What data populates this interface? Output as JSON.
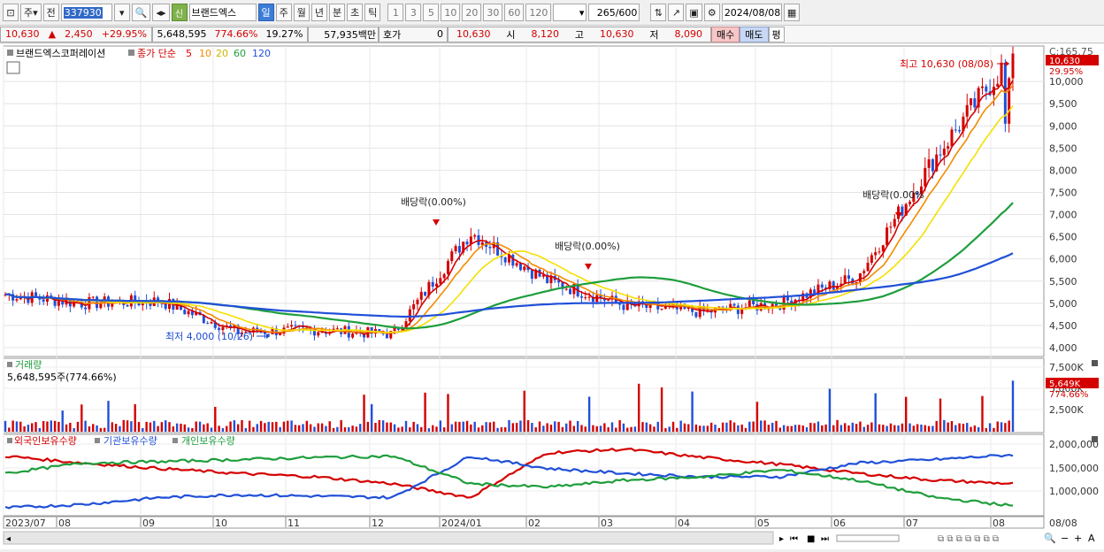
{
  "toolbar": {
    "period_type": "주",
    "prev_label": "전",
    "code": "337930",
    "new_badge": "신",
    "stock_name": "브랜드엑스",
    "intervals": [
      "일",
      "주",
      "월",
      "년",
      "분",
      "초",
      "틱"
    ],
    "selected_interval": "일",
    "numbers": [
      "1",
      "3",
      "5",
      "10",
      "20",
      "30",
      "60",
      "120"
    ],
    "count": "265",
    "count_max": "/600",
    "date": "2024/08/08"
  },
  "quote": {
    "price": "10,630",
    "change": "2,450",
    "change_pct": "+29.95%",
    "volume": "5,648,595",
    "volume_ratio": "774.66%",
    "turnover": "19.27%",
    "amount": "57,935백만",
    "hoga_label": "호가",
    "hoga_value": "0",
    "bid": "10,630",
    "open_label": "시",
    "open": "8,120",
    "high_label": "고",
    "high": "10,630",
    "low_label": "저",
    "low": "8,090",
    "buy_label": "매수",
    "sell_label": "매도",
    "avg_label": "평"
  },
  "price_panel": {
    "stock_label": "브랜드엑스코퍼레이션",
    "ma_title": "종가 단순",
    "ma_periods": [
      "5",
      "10",
      "20",
      "60",
      "120"
    ],
    "ma_colors": [
      "#d40000",
      "#f28c00",
      "#f5e000",
      "#1e9e3c",
      "#2050d8"
    ],
    "top_label": "C:165.75",
    "current_box": "10,630",
    "current_pct": "29.95%",
    "y_ticks": [
      "10,000",
      "9,500",
      "9,000",
      "8,500",
      "8,000",
      "7,500",
      "7,000",
      "6,500",
      "6,000",
      "5,500",
      "5,000",
      "4,500",
      "4,000"
    ],
    "y_values": [
      10000,
      9500,
      9000,
      8500,
      8000,
      7500,
      7000,
      6500,
      6000,
      5500,
      5000,
      4500,
      4000
    ],
    "high_note": "최고 10,630 (08/08)",
    "low_note": "최저 4,000 (10/26)",
    "dividend_label": "배당락(0.00%)",
    "dividend_label_cut": "배당락(0.00%"
  },
  "volume_panel": {
    "title": "거래량",
    "value_text": "5,648,595주(774.66%)",
    "y_ticks": [
      "7,500K",
      "5,000K",
      "2,500K"
    ],
    "current_box": "5,649K",
    "current_pct": "774.66%"
  },
  "holding_panel": {
    "series": [
      "외국인보유수량",
      "기관보유수량",
      "개인보유수량"
    ],
    "colors": [
      "#d40000",
      "#2050d8",
      "#1e9e3c"
    ],
    "y_ticks": [
      "2,000,000",
      "1,500,000",
      "1,000,000"
    ]
  },
  "xaxis": {
    "labels": [
      "2023/07",
      "08",
      "09",
      "10",
      "11",
      "12",
      "2024/01",
      "02",
      "03",
      "04",
      "05",
      "06",
      "07",
      "08"
    ],
    "end_label": "08/08"
  },
  "chart_data": {
    "type": "line",
    "title": "브랜드엑스코퍼레이션",
    "ylabel": "",
    "ylim": [
      3800,
      10800
    ],
    "x": [
      "2023/07",
      "2023/08",
      "2023/09",
      "2023/10",
      "2023/11",
      "2023/12",
      "2024/01",
      "2024/02",
      "2024/03",
      "2024/04",
      "2024/05",
      "2024/06",
      "2024/07",
      "2024/08/08"
    ],
    "series": [
      {
        "name": "5",
        "values": [
          5200,
          5000,
          5050,
          4350,
          4400,
          4300,
          6600,
          5500,
          4950,
          4800,
          5000,
          5600,
          8300,
          10630
        ]
      },
      {
        "name": "60",
        "values": [
          5350,
          5200,
          5150,
          4900,
          4600,
          4500,
          5200,
          5600,
          5800,
          5400,
          5050,
          5100,
          6200,
          6700
        ]
      },
      {
        "name": "120",
        "values": [
          5500,
          5300,
          5200,
          5100,
          4900,
          4700,
          4900,
          5100,
          5200,
          5250,
          5300,
          5400,
          5600,
          5900
        ]
      }
    ],
    "low": {
      "value": 4000,
      "date": "10/26"
    },
    "high": {
      "value": 10630,
      "date": "08/08"
    }
  }
}
